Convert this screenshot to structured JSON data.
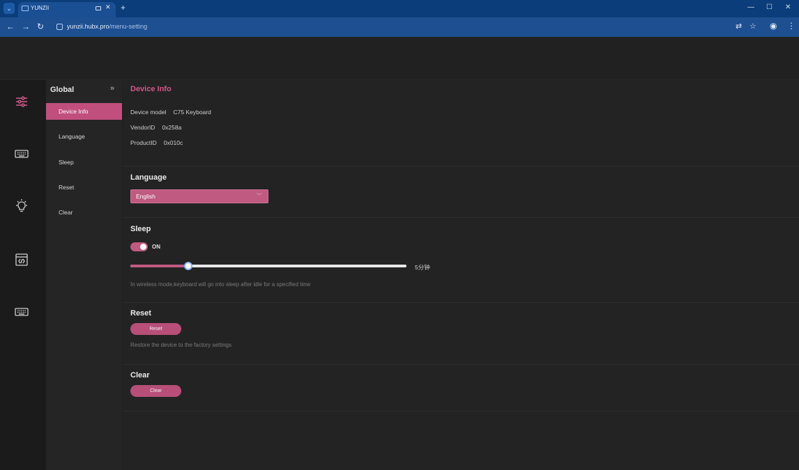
{
  "browser": {
    "tab_title": "YUNZII",
    "tab_icon": "monitor-icon",
    "url_host": "yunzii.hubx.pro",
    "url_path": "/menu-setting",
    "window_controls": [
      "minimize-icon",
      "maximize-icon",
      "close-icon"
    ]
  },
  "rail": {
    "items": [
      {
        "icon": "settings-sliders-icon",
        "active": true
      },
      {
        "icon": "keyboard-icon",
        "active": false
      },
      {
        "icon": "lightbulb-icon",
        "active": false
      },
      {
        "icon": "code-window-icon",
        "active": false
      },
      {
        "icon": "keyboard-macro-icon",
        "active": false
      }
    ]
  },
  "submenu": {
    "title": "Global",
    "items": [
      {
        "label": "Device Info",
        "active": true
      },
      {
        "label": "Language",
        "active": false
      },
      {
        "label": "Sleep",
        "active": false
      },
      {
        "label": "Reset",
        "active": false
      },
      {
        "label": "Clear",
        "active": false
      }
    ]
  },
  "device_info": {
    "title": "Device Info",
    "rows": [
      {
        "label": "Device model",
        "value": "C75 Keyboard"
      },
      {
        "label": "VendorID",
        "value": "0x258a"
      },
      {
        "label": "ProductID",
        "value": "0x010c"
      }
    ]
  },
  "language": {
    "title": "Language",
    "selected": "English"
  },
  "sleep": {
    "title": "Sleep",
    "toggle_label": "ON",
    "enabled": true,
    "slider_fraction": 0.21,
    "slider_value": "5分钟",
    "hint": "In wireless mode,keyboard will go into sleep after idle for a specified time"
  },
  "reset": {
    "title": "Reset",
    "button": "Reset",
    "hint": "Restore the device to the factory settings"
  },
  "clear": {
    "title": "Clear",
    "button": "Clear"
  },
  "colors": {
    "accent": "#c05a80",
    "accent_text": "#d4578a",
    "browser_chrome": "#1d4f91"
  }
}
